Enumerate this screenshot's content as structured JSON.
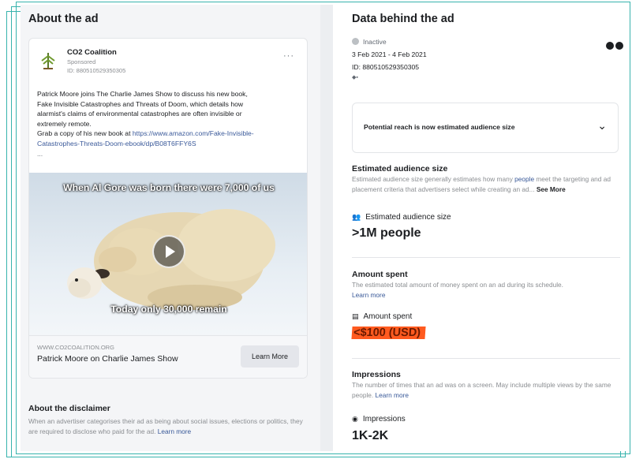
{
  "left": {
    "title": "About the ad",
    "ad": {
      "advertiser": "CO2 Coalition",
      "sponsored": "Sponsored",
      "id_label": "ID: 880510529350305",
      "more_label": "···",
      "body_lines": [
        "Patrick Moore joins The Charlie James Show to discuss his new book,",
        "Fake Invisible Catastrophes and Threats of Doom, which details how",
        "alarmist's claims of environmental catastrophes are often invisible or",
        "extremely remote."
      ],
      "grab_text": "Grab a copy of his new book at ",
      "link_line1": "https://www.amazon.com/Fake-Invisible-",
      "link_line2": "Catastrophes-Threats-Doom-ebook/dp/B08T6FFY6S",
      "ellipsis": "...",
      "image_caption_top": "When Al Gore was born there were 7,000 of us",
      "image_caption_bottom": "Today only 30,000 remain",
      "domain": "WWW.CO2COALITION.ORG",
      "headline": "Patrick Moore on Charlie James Show",
      "cta": "Learn More"
    },
    "disclaimer": {
      "title": "About the disclaimer",
      "text": "When an advertiser categorises their ad as being about social issues, elections or politics, they are required to disclose who paid for the ad. ",
      "link": "Learn more"
    }
  },
  "right": {
    "title": "Data behind the ad",
    "status": "Inactive",
    "dates": "3 Feb 2021 - 4 Feb 2021",
    "id_label": "ID: 880510529350305",
    "reach_box": "Potential reach is now estimated audience size",
    "audience": {
      "title": "Estimated audience size",
      "desc_before_link": "Estimated audience size generally estimates how many ",
      "desc_link": "people",
      "desc_after_link": " meet the targeting and ad placement criteria that advertisers select while creating an ad... ",
      "see_more": "See More",
      "label": "Estimated audience size",
      "value": ">1M people"
    },
    "spent": {
      "title": "Amount spent",
      "desc": "The estimated total amount of money spent on an ad during its schedule.",
      "link": "Learn more",
      "label": "Amount spent",
      "value": "<$100 (USD)"
    },
    "impressions": {
      "title": "Impressions",
      "desc": "The number of times that an ad was on a screen. May include multiple views by the same people. ",
      "link": "Learn more",
      "label": "Impressions",
      "value": "1K-2K"
    }
  },
  "colors": {
    "frame": "#37b3ad",
    "highlight": "#ff5a1f",
    "link": "#385898"
  }
}
